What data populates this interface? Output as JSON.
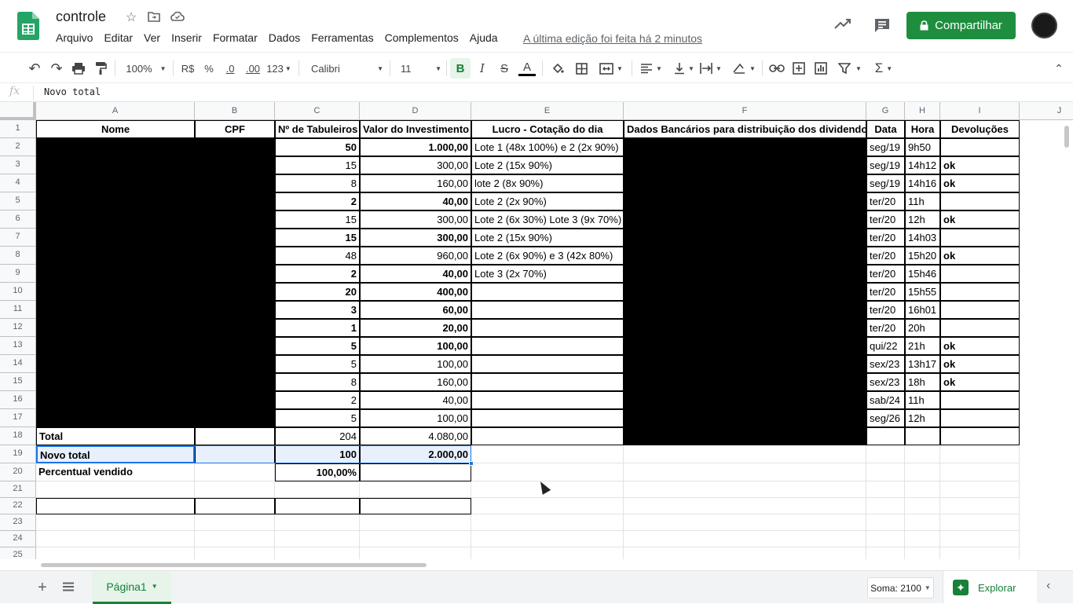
{
  "app": {
    "doc_title": "controle",
    "menu": [
      "Arquivo",
      "Editar",
      "Ver",
      "Inserir",
      "Formatar",
      "Dados",
      "Ferramentas",
      "Complementos",
      "Ajuda"
    ],
    "last_edit": "A última edição foi feita há 2 minutos",
    "share_label": "Compartilhar"
  },
  "toolbar": {
    "zoom": "100%",
    "currency": "R$",
    "percent": "%",
    "dec_less": ".0",
    "dec_more": ".00",
    "format_more": "123",
    "font": "Calibri",
    "font_size": "11",
    "bold": "B",
    "italic": "I",
    "strike": "S",
    "text_color": "A"
  },
  "formula": {
    "fx": "fx",
    "value": "Novo total"
  },
  "columns": [
    "A",
    "B",
    "C",
    "D",
    "E",
    "F",
    "G",
    "H",
    "I",
    "J"
  ],
  "rows": [
    "1",
    "2",
    "3",
    "4",
    "5",
    "6",
    "7",
    "8",
    "9",
    "10",
    "11",
    "12",
    "13",
    "14",
    "15",
    "16",
    "17",
    "18",
    "19",
    "20",
    "21",
    "22",
    "23",
    "24",
    "25"
  ],
  "headers": {
    "nome": "Nome",
    "cpf": "CPF",
    "tabuleiros": "Nº de Tabuleiros",
    "investimento": "Valor do Investimento",
    "lucro": "Lucro - Cotação do dia",
    "bancarios": "Dados Bancários para distribuição dos dividendos",
    "data": "Data",
    "hora": "Hora",
    "devolucoes": "Devoluções"
  },
  "entries": [
    {
      "c": "50",
      "d": "1.000,00",
      "e": "Lote 1 (48x 100%) e 2 (2x 90%)",
      "g": "seg/19",
      "h": "9h50",
      "i": "",
      "bold": true
    },
    {
      "c": "15",
      "d": "300,00",
      "e": "Lote 2 (15x 90%)",
      "g": "seg/19",
      "h": "14h12",
      "i": "ok",
      "bold": false
    },
    {
      "c": "8",
      "d": "160,00",
      "e": "lote 2 (8x 90%)",
      "g": "seg/19",
      "h": "14h16",
      "i": "ok",
      "bold": false
    },
    {
      "c": "2",
      "d": "40,00",
      "e": "Lote 2 (2x 90%)",
      "g": "ter/20",
      "h": "11h",
      "i": "",
      "bold": true
    },
    {
      "c": "15",
      "d": "300,00",
      "e": "Lote 2 (6x 30%) Lote 3 (9x 70%)",
      "g": "ter/20",
      "h": "12h",
      "i": "ok",
      "bold": false
    },
    {
      "c": "15",
      "d": "300,00",
      "e": "Lote 2 (15x 90%)",
      "g": "ter/20",
      "h": "14h03",
      "i": "",
      "bold": true
    },
    {
      "c": "48",
      "d": "960,00",
      "e": "Lote 2 (6x 90%) e 3 (42x 80%)",
      "g": "ter/20",
      "h": "15h20",
      "i": "ok",
      "bold": false
    },
    {
      "c": "2",
      "d": "40,00",
      "e": "Lote 3 (2x 70%)",
      "g": "ter/20",
      "h": "15h46",
      "i": "",
      "bold": true
    },
    {
      "c": "20",
      "d": "400,00",
      "e": "",
      "g": "ter/20",
      "h": "15h55",
      "i": "",
      "bold": true
    },
    {
      "c": "3",
      "d": "60,00",
      "e": "",
      "g": "ter/20",
      "h": "16h01",
      "i": "",
      "bold": true
    },
    {
      "c": "1",
      "d": "20,00",
      "e": "",
      "g": "ter/20",
      "h": "20h",
      "i": "",
      "bold": true
    },
    {
      "c": "5",
      "d": "100,00",
      "e": "",
      "g": "qui/22",
      "h": "21h",
      "i": "ok",
      "bold": true
    },
    {
      "c": "5",
      "d": "100,00",
      "e": "",
      "g": "sex/23",
      "h": "13h17",
      "i": "ok",
      "bold": false
    },
    {
      "c": "8",
      "d": "160,00",
      "e": "",
      "g": "sex/23",
      "h": "18h",
      "i": "ok",
      "bold": false
    },
    {
      "c": "2",
      "d": "40,00",
      "e": "",
      "g": "sab/24",
      "h": "11h",
      "i": "",
      "bold": false
    },
    {
      "c": "5",
      "d": "100,00",
      "e": "",
      "g": "seg/26",
      "h": "12h",
      "i": "",
      "bold": false
    }
  ],
  "total": {
    "label": "Total",
    "c": "204",
    "d": "4.080,00"
  },
  "novo_total": {
    "label": "Novo total",
    "c": "100",
    "d": "2.000,00"
  },
  "percentual": {
    "label": "Percentual vendido",
    "c": "100,00%"
  },
  "bottom": {
    "sheet_name": "Página1",
    "sum": "Soma: 2100",
    "explore": "Explorar"
  },
  "colors": {
    "brand": "#1e8e3e",
    "selection": "#1a73e8"
  }
}
